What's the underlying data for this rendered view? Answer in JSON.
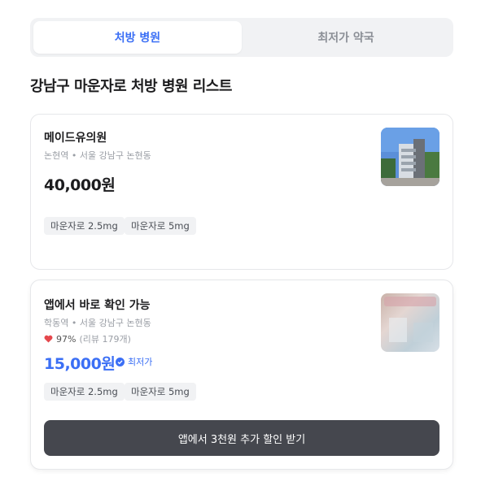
{
  "tabs": [
    {
      "label": "처방 병원",
      "active": true
    },
    {
      "label": "최저가 약국",
      "active": false
    }
  ],
  "heading": "강남구 마운자로 처방 병원 리스트",
  "colors": {
    "accent": "#3b6ff5",
    "cta_bg": "#45474e",
    "heart": "#e5484d"
  },
  "cards": [
    {
      "name": "메이드유의원",
      "address": "논현역 • 서울 강남구 논현동",
      "price": "40,000원",
      "chips": [
        "마운자로 2.5mg",
        "마운자로 5mg"
      ]
    },
    {
      "name": "앱에서 바로 확인 가능",
      "address": "학동역 • 서울 강남구 논현동",
      "rating": "97%",
      "reviews": "(리뷰 179개)",
      "price": "15,000원",
      "badge": "최저가",
      "chips": [
        "마운자로 2.5mg",
        "마운자로 5mg"
      ],
      "cta": "앱에서 3천원 추가 할인 받기"
    }
  ]
}
